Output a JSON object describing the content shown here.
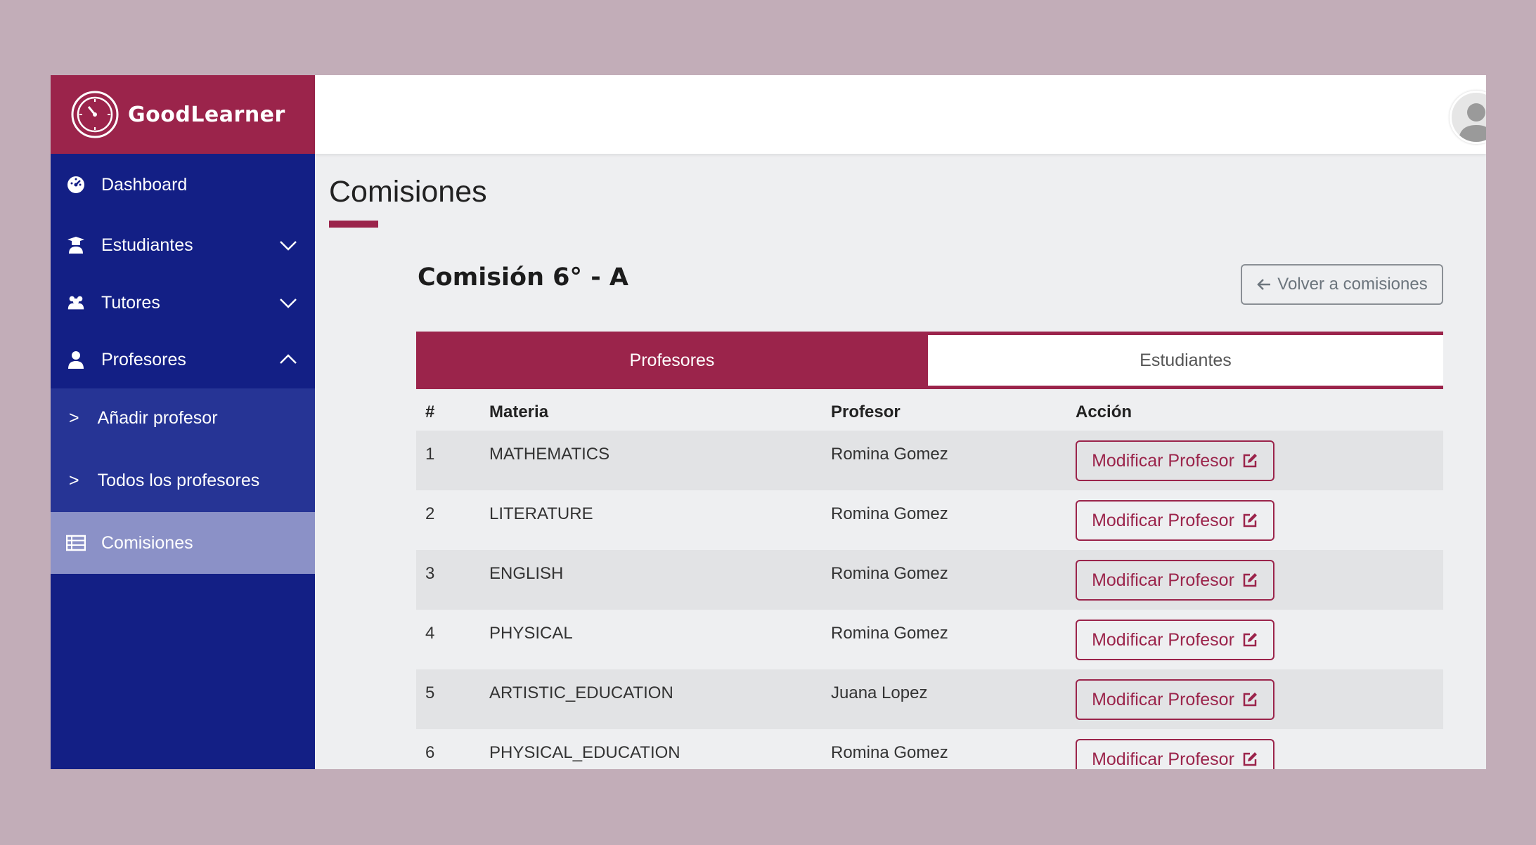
{
  "brand": {
    "name": "GoodLearner"
  },
  "sidebar": {
    "items": [
      {
        "label": "Dashboard",
        "icon": "dashboard-icon"
      },
      {
        "label": "Estudiantes",
        "icon": "student-icon"
      },
      {
        "label": "Tutores",
        "icon": "users-icon"
      },
      {
        "label": "Profesores",
        "icon": "user-icon"
      }
    ],
    "submenu": [
      {
        "label": "Añadir profesor"
      },
      {
        "label": "Todos los profesores"
      }
    ],
    "active": {
      "label": "Comisiones",
      "icon": "table-icon"
    }
  },
  "page": {
    "title": "Comisiones"
  },
  "commission": {
    "title": "Comisión 6° - A",
    "back_label": "Volver a comisiones"
  },
  "tabs": [
    {
      "label": "Profesores",
      "active": true
    },
    {
      "label": "Estudiantes",
      "active": false
    }
  ],
  "table": {
    "headers": [
      "#",
      "Materia",
      "Profesor",
      "Acción"
    ],
    "action_label": "Modificar Profesor",
    "rows": [
      {
        "num": "1",
        "materia": "MATHEMATICS",
        "profesor": "Romina Gomez"
      },
      {
        "num": "2",
        "materia": "LITERATURE",
        "profesor": "Romina Gomez"
      },
      {
        "num": "3",
        "materia": "ENGLISH",
        "profesor": "Romina Gomez"
      },
      {
        "num": "4",
        "materia": "PHYSICAL",
        "profesor": "Romina Gomez"
      },
      {
        "num": "5",
        "materia": "ARTISTIC_EDUCATION",
        "profesor": "Juana Lopez"
      },
      {
        "num": "6",
        "materia": "PHYSICAL_EDUCATION",
        "profesor": "Romina Gomez"
      }
    ]
  },
  "colors": {
    "brand": "#9b244b",
    "sidebar": "#131f85",
    "sidebar_active": "#8b91c7"
  }
}
